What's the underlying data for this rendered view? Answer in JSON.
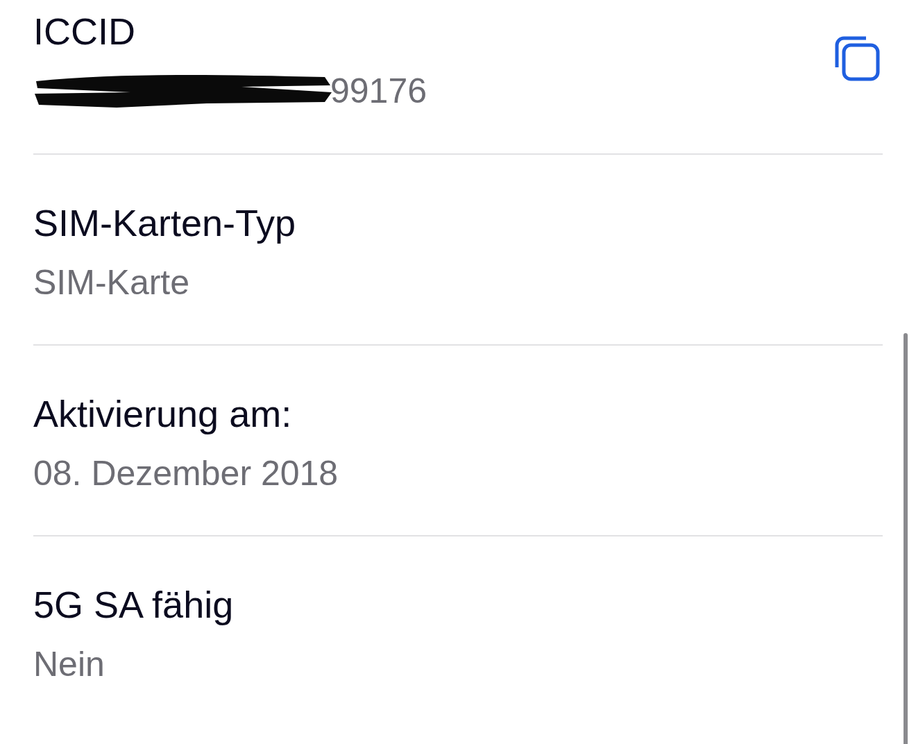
{
  "fields": [
    {
      "label": "ICCID",
      "value": "99176",
      "redacted": true,
      "copyable": true
    },
    {
      "label": "SIM-Karten-Typ",
      "value": "SIM-Karte"
    },
    {
      "label": "Aktivierung am:",
      "value": "08. Dezember 2018"
    },
    {
      "label": "5G SA fähig",
      "value": "Nein"
    }
  ]
}
